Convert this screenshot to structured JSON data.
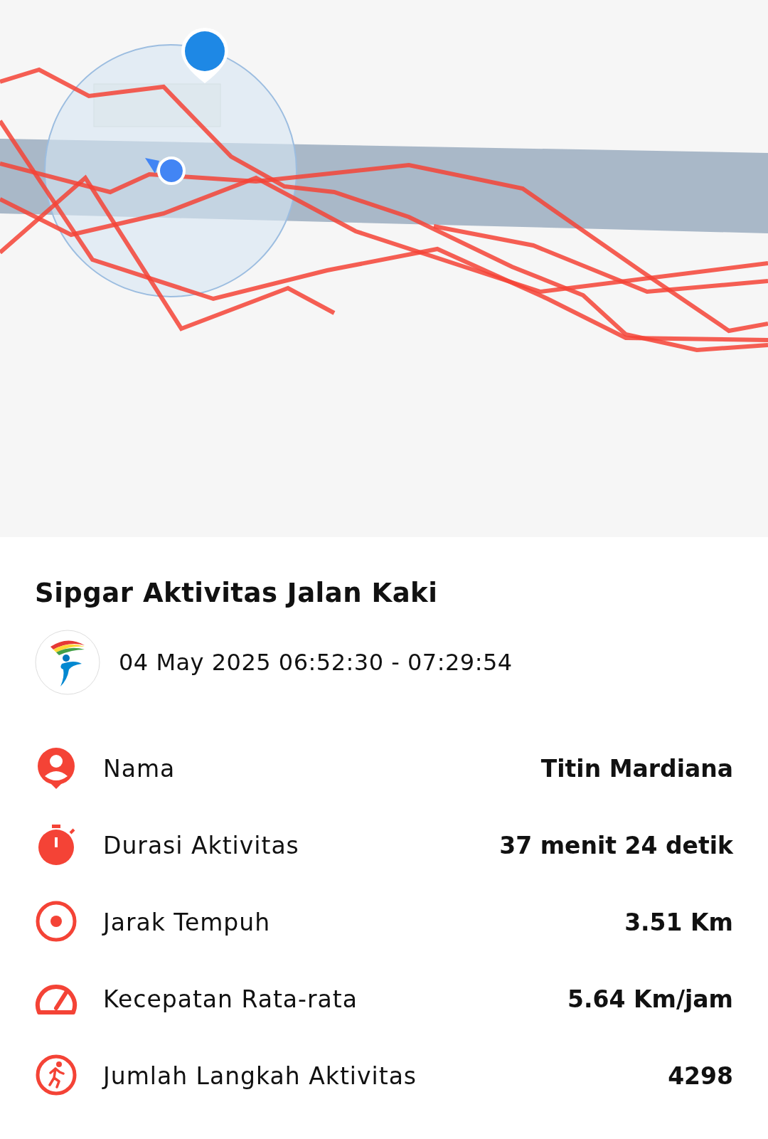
{
  "title": "Sipgar Aktivitas Jalan Kaki",
  "time_range": "04 May 2025 06:52:30 - 07:29:54",
  "stats": [
    {
      "kind": "person",
      "label": "Nama",
      "value": "Titin Mardiana"
    },
    {
      "kind": "timer",
      "label": "Durasi Aktivitas",
      "value": "37 menit 24 detik"
    },
    {
      "kind": "target",
      "label": "Jarak Tempuh",
      "value": "3.51 Km"
    },
    {
      "kind": "speed",
      "label": "Kecepatan Rata-rata",
      "value": "5.64 Km/jam"
    },
    {
      "kind": "runner",
      "label": "Jumlah Langkah Aktivitas",
      "value": "4298"
    }
  ]
}
